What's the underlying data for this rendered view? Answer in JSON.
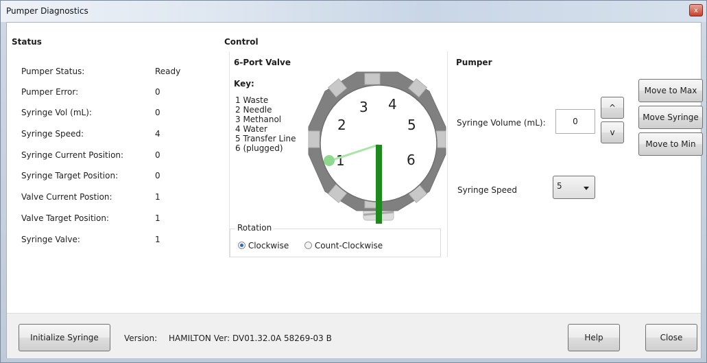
{
  "window": {
    "title": "Pumper Diagnostics",
    "close_glyph": "x"
  },
  "status": {
    "heading": "Status",
    "rows": [
      {
        "label": "Pumper Status:",
        "value": "Ready"
      },
      {
        "label": "Pumper Error:",
        "value": "0"
      },
      {
        "label": "Syringe Vol (mL):",
        "value": "0"
      },
      {
        "label": "Syringe Speed:",
        "value": "4"
      },
      {
        "label": "Syringe Current Position:",
        "value": "0"
      },
      {
        "label": "Syringe Target Position:",
        "value": "0"
      },
      {
        "label": "Valve Current Postion:",
        "value": "1"
      },
      {
        "label": "Valve Target Position:",
        "value": "1"
      },
      {
        "label": "Syringe Valve:",
        "value": "1"
      }
    ]
  },
  "control": {
    "heading": "Control",
    "valve": {
      "heading": "6-Port Valve",
      "key_heading": "Key:",
      "key_items": [
        "1 Waste",
        "2 Needle",
        "3 Methanol",
        "4 Water",
        "5 Transfer Line",
        "6 (plugged)"
      ],
      "port_numbers": [
        "1",
        "2",
        "3",
        "4",
        "5",
        "6"
      ],
      "current_port": 1
    },
    "rotation": {
      "legend": "Rotation",
      "options": [
        {
          "label": "Clockwise",
          "selected": true
        },
        {
          "label": "Count-Clockwise",
          "selected": false
        }
      ]
    }
  },
  "pumper": {
    "heading": "Pumper",
    "volume_label": "Syringe Volume (mL):",
    "volume_value": "0",
    "up_glyph": "^",
    "down_glyph": "v",
    "move_max": "Move to Max",
    "move_syringe": "Move Syringe",
    "move_min": "Move to Min",
    "speed_label": "Syringe Speed",
    "speed_value": "5"
  },
  "footer": {
    "init_button": "Initialize Syringe",
    "version_label": "Version:",
    "version_value": "HAMILTON Ver: DV01.32.0A 58269-03 B",
    "help_button": "Help",
    "close_button": "Close"
  },
  "colors": {
    "valve_ring": "#7f7f7f",
    "active_port": "#8fd98f",
    "handle_long": "#1e8a1e",
    "handle_short": "#a8e6a8",
    "radio_selected": "#2d66c2"
  }
}
